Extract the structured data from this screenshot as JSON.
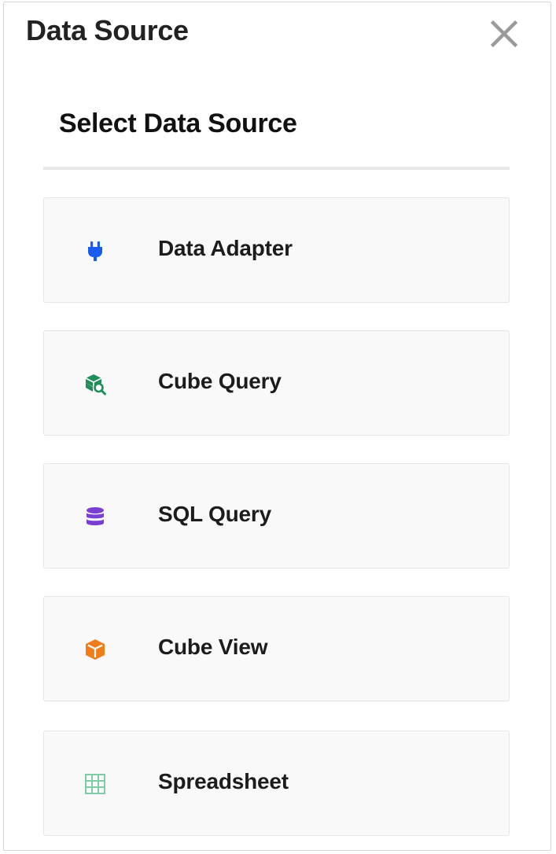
{
  "panel": {
    "title": "Data Source",
    "close_icon": "close-icon"
  },
  "section": {
    "title": "Select Data Source"
  },
  "options": [
    {
      "label": "Data Adapter",
      "icon": "plug-icon",
      "color": "#1a5cf2"
    },
    {
      "label": "Cube Query",
      "icon": "cube-search-icon",
      "color": "#1e8e5a"
    },
    {
      "label": "SQL Query",
      "icon": "database-icon",
      "color": "#7b3fd1"
    },
    {
      "label": "Cube View",
      "icon": "cube-icon",
      "color": "#f07c1a"
    },
    {
      "label": "Spreadsheet",
      "icon": "table-grid-icon",
      "color": "#7fcba6"
    }
  ]
}
